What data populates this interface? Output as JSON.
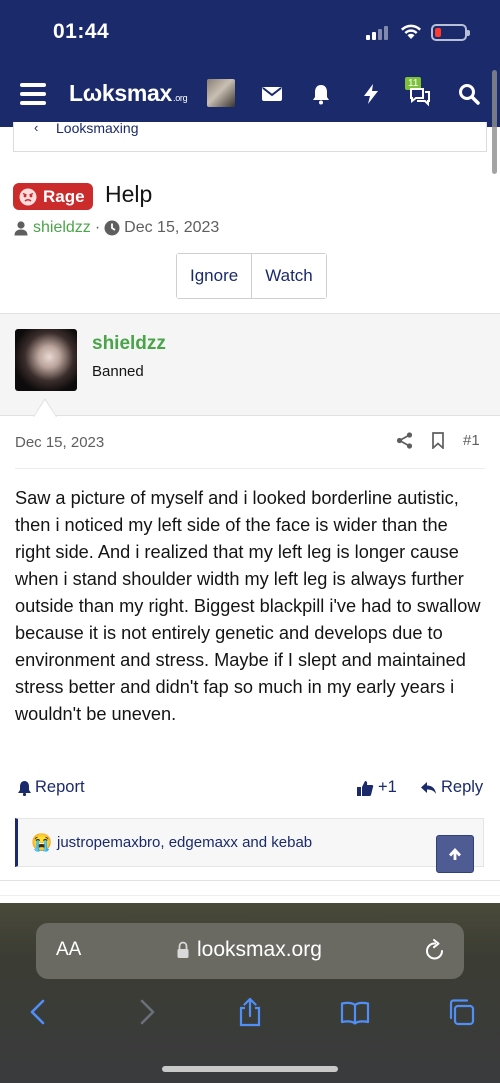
{
  "status_bar": {
    "time": "01:44"
  },
  "header": {
    "logo_main": "Lωksmax",
    "logo_suffix": ".org",
    "alerts_badge": "11"
  },
  "breadcrumb": {
    "label": "Looksmaxing"
  },
  "thread": {
    "prefix": "Rage",
    "title": "Help",
    "author": "shieldzz",
    "separator": "·",
    "date": "Dec 15, 2023",
    "ignore_label": "Ignore",
    "watch_label": "Watch"
  },
  "post": {
    "username": "shieldzz",
    "user_title": "Banned",
    "date": "Dec 15, 2023",
    "number": "#1",
    "body": "Saw a picture of myself and i looked borderline autistic, then i noticed my left side of the face is wider than the right side. And i realized that my left leg is longer cause when i stand shoulder width my left leg is always further outside than my right. Biggest blackpill i've had to swallow because it is not entirely genetic and develops due to environment and stress. Maybe if I slept and maintained stress better and didn't fap so much in my early years i wouldn't be uneven.",
    "report_label": "Report",
    "like_count": "+1",
    "reply_label": "Reply",
    "reaction_emoji": "😭",
    "reaction_users": "justropemaxbro, edgemaxx and kebab"
  },
  "safari": {
    "text_size_label": "AA",
    "url": "looksmax.org"
  },
  "colors": {
    "header_bg": "#1b2a6b",
    "rage_prefix": "#cc2b2b",
    "username_green": "#4aa44a",
    "link_blue": "#1b2a6b"
  },
  "icons": [
    "hamburger-icon",
    "mail-icon",
    "bell-icon",
    "bolt-icon",
    "chat-icon",
    "search-icon",
    "user-icon",
    "clock-icon",
    "share-icon",
    "bookmark-icon",
    "bell-report-icon",
    "thumbs-up-icon",
    "reply-arrow-icon",
    "arrow-up-icon",
    "lock-icon",
    "reload-icon",
    "back-icon",
    "forward-icon",
    "share-sheet-icon",
    "book-icon",
    "tabs-icon"
  ]
}
